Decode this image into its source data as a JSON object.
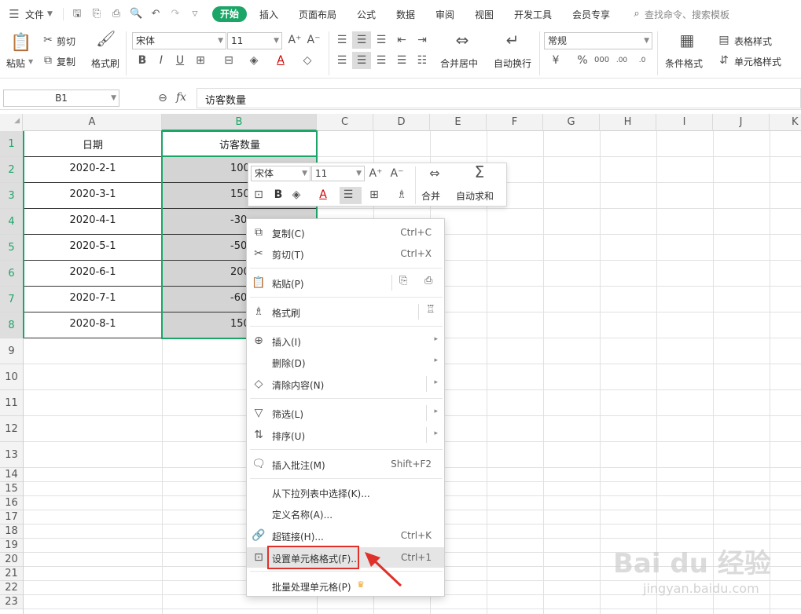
{
  "menubar": {
    "file_label": "文件",
    "tabs": [
      "开始",
      "插入",
      "页面布局",
      "公式",
      "数据",
      "审阅",
      "视图",
      "开发工具",
      "会员专享"
    ],
    "search_placeholder": "查找命令、搜索模板"
  },
  "ribbon": {
    "paste": "粘贴",
    "cut": "剪切",
    "copy": "复制",
    "format_painter": "格式刷",
    "font_name": "宋体",
    "font_size": "11",
    "merge_center": "合并居中",
    "wrap_text": "自动换行",
    "number_format": "常规",
    "cond_format": "条件格式",
    "table_style": "表格样式",
    "cell_style": "单元格样式"
  },
  "formula_bar": {
    "name_box": "B1",
    "fx": "fx",
    "content": "访客数量"
  },
  "grid": {
    "columns": [
      "A",
      "B",
      "C",
      "D",
      "E",
      "F",
      "G",
      "H",
      "I",
      "J",
      "K"
    ],
    "rows": [
      "1",
      "2",
      "3",
      "4",
      "5",
      "6",
      "7",
      "8",
      "9",
      "10",
      "11",
      "12",
      "13",
      "14",
      "15",
      "16",
      "17",
      "18",
      "19",
      "20",
      "21",
      "22",
      "23"
    ],
    "header": {
      "a": "日期",
      "b": "访客数量"
    },
    "data": [
      {
        "date": "2020-2-1",
        "visits": "100"
      },
      {
        "date": "2020-3-1",
        "visits": "150"
      },
      {
        "date": "2020-4-1",
        "visits": "-30"
      },
      {
        "date": "2020-5-1",
        "visits": "-50"
      },
      {
        "date": "2020-6-1",
        "visits": "200"
      },
      {
        "date": "2020-7-1",
        "visits": "-60"
      },
      {
        "date": "2020-8-1",
        "visits": "150"
      }
    ]
  },
  "mini_toolbar": {
    "font_name": "宋体",
    "font_size": "11",
    "merge": "合并",
    "autosum": "自动求和"
  },
  "context_menu": {
    "copy": "复制(C)",
    "copy_sc": "Ctrl+C",
    "cut": "剪切(T)",
    "cut_sc": "Ctrl+X",
    "paste": "粘贴(P)",
    "format_painter": "格式刷",
    "insert": "插入(I)",
    "delete": "删除(D)",
    "clear": "清除内容(N)",
    "filter": "筛选(L)",
    "sort": "排序(U)",
    "insert_comment": "插入批注(M)",
    "insert_comment_sc": "Shift+F2",
    "pick_from_list": "从下拉列表中选择(K)...",
    "define_name": "定义名称(A)...",
    "hyperlink": "超链接(H)...",
    "hyperlink_sc": "Ctrl+K",
    "format_cells": "设置单元格格式(F)...",
    "format_cells_sc": "Ctrl+1",
    "batch_process": "批量处理单元格(P)"
  },
  "watermark": {
    "brand": "Bai du 经验",
    "url": "jingyan.baidu.com"
  },
  "colors": {
    "accent": "#1ba667",
    "highlight_box": "#e0302a",
    "selection": "#d4d4d4"
  }
}
